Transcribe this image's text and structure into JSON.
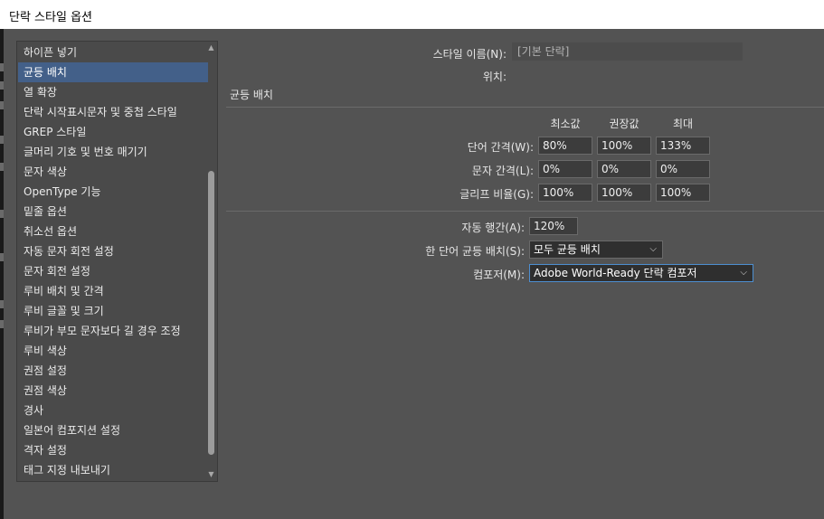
{
  "window": {
    "title": "단락 스타일 옵션"
  },
  "categories": {
    "items": [
      "하이픈 넣기",
      "균등 배치",
      "열 확장",
      "단락 시작표시문자 및 중첩 스타일",
      "GREP 스타일",
      "글머리 기호 및 번호 매기기",
      "문자 색상",
      "OpenType 기능",
      "밑줄 옵션",
      "취소선 옵션",
      "자동 문자 회전 설정",
      "문자 회전 설정",
      "루비 배치 및 간격",
      "루비 글꼴 및 크기",
      "루비가 부모 문자보다 길 경우 조정",
      "루비 색상",
      "권점 설정",
      "권점 색상",
      "경사",
      "일본어 컴포지션 설정",
      "격자 설정",
      "태그 지정 내보내기"
    ],
    "selected": "균등 배치",
    "scroll_up_glyph": "▲",
    "scroll_down_glyph": "▼"
  },
  "header": {
    "style_name_label": "스타일 이름(N):",
    "style_name_value": "[기본 단락]",
    "location_label": "위치:",
    "section_title": "균등 배치"
  },
  "spacing": {
    "col_min": "최소값",
    "col_desired": "권장값",
    "col_max": "최대",
    "rows": [
      {
        "label": "단어 간격(W):",
        "min": "80%",
        "desired": "100%",
        "max": "133%"
      },
      {
        "label": "문자 간격(L):",
        "min": "0%",
        "desired": "0%",
        "max": "0%"
      },
      {
        "label": "글리프 비율(G):",
        "min": "100%",
        "desired": "100%",
        "max": "100%"
      }
    ]
  },
  "options": {
    "auto_leading_label": "자동 행간(A):",
    "auto_leading_value": "120%",
    "single_word_label": "한 단어 균등 배치(S):",
    "single_word_value": "모두 균등 배치",
    "composer_label": "컴포저(M):",
    "composer_value": "Adobe  World-Ready 단락 컴포저",
    "dropdown_glyph": "⌵"
  },
  "colors": {
    "background": "#535353",
    "selection": "#436089",
    "focus_border": "#4d8fd1"
  }
}
